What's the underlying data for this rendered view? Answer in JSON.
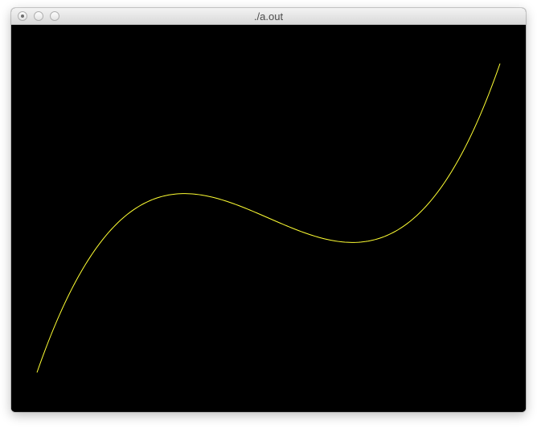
{
  "window": {
    "title": "./a.out"
  },
  "icons": {
    "close": "close-icon",
    "minimize": "minimize-icon",
    "zoom": "zoom-icon"
  },
  "colors": {
    "canvas_background": "#000000",
    "curve": "#ffff33"
  },
  "plot": {
    "function": "cubic",
    "description_points": [
      [
        -1.0,
        -1.0
      ],
      [
        -0.5,
        0.12
      ],
      [
        0.0,
        0.0
      ],
      [
        0.5,
        -0.12
      ],
      [
        1.0,
        1.0
      ]
    ]
  }
}
